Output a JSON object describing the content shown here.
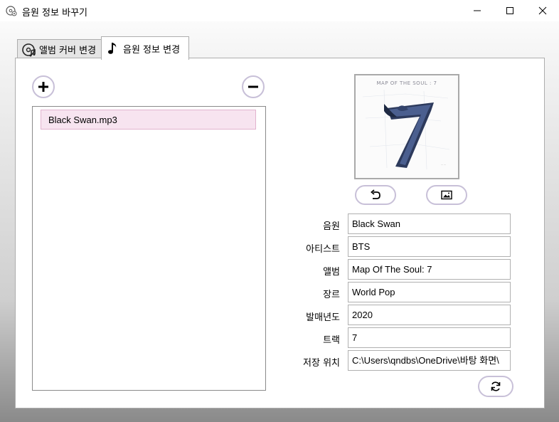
{
  "window": {
    "title": "음원 정보 바꾸기",
    "app_icon": "disc-settings-icon",
    "controls": [
      "minimize-icon",
      "maximize-icon",
      "close-icon"
    ]
  },
  "tabs": [
    {
      "label": "앨범 커버 변경",
      "icon": "album-cover-icon",
      "active": false
    },
    {
      "label": "음원 정보 변경",
      "icon": "music-note-icon",
      "active": true
    }
  ],
  "file_list": {
    "add_icon": "plus-icon",
    "remove_icon": "minus-icon",
    "items": [
      "Black Swan.mp3"
    ],
    "selected_index": 0
  },
  "album_cover": {
    "title_text": "MAP OF THE SOUL : 7",
    "big_numeral": "7",
    "undo_icon": "undo-icon",
    "image_icon": "image-icon"
  },
  "fields": [
    {
      "label": "음원",
      "value": "Black Swan"
    },
    {
      "label": "아티스트",
      "value": "BTS"
    },
    {
      "label": "앨범",
      "value": "Map Of The Soul: 7"
    },
    {
      "label": "장르",
      "value": "World Pop"
    },
    {
      "label": "발매년도",
      "value": "2020"
    },
    {
      "label": "트랙",
      "value": "7"
    },
    {
      "label": "저장 위치",
      "value": "C:\\Users\\qndbs\\OneDrive\\바탕 화면\\"
    }
  ],
  "refresh_icon": "refresh-icon",
  "colors": {
    "selection_fill": "#f7e4f0",
    "selection_border": "#e2b3cf",
    "button_border": "#c8c0d8"
  }
}
